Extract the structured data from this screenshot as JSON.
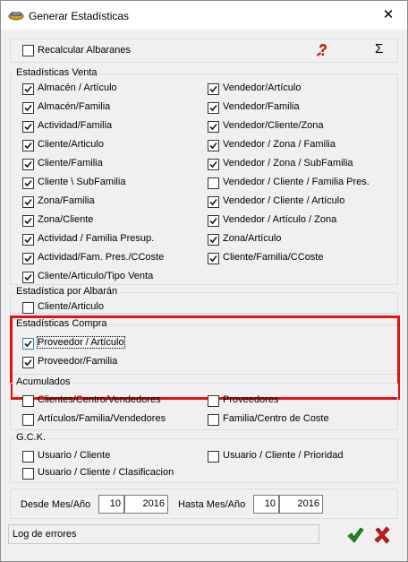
{
  "window": {
    "title": "Generar Estadísticas"
  },
  "top": {
    "recalcular_label": "Recalcular Albaranes",
    "sigma_symbol": "Σ"
  },
  "venta": {
    "title": "Estadísticas Venta",
    "left": [
      {
        "label": "Almacén / Artículo",
        "checked": true
      },
      {
        "label": "Almacén/Familia",
        "checked": true
      },
      {
        "label": "Actividad/Familia",
        "checked": true
      },
      {
        "label": "Cliente/Articulo",
        "checked": true
      },
      {
        "label": "Cliente/Familia",
        "checked": true
      },
      {
        "label": "Cliente \\ SubFamilia",
        "checked": true
      },
      {
        "label": "Zona/Familia",
        "checked": true
      },
      {
        "label": "Zona/Cliente",
        "checked": true
      },
      {
        "label": "Actividad / Familia Presup.",
        "checked": true
      },
      {
        "label": "Actividad/Fam. Pres./CCoste",
        "checked": true
      },
      {
        "label": "Cliente/Articulo/Tipo Venta",
        "checked": true
      }
    ],
    "right": [
      {
        "label": "Vendedor/Artículo",
        "checked": true
      },
      {
        "label": "Vendedor/Familia",
        "checked": true
      },
      {
        "label": "Vendedor/Cliente/Zona",
        "checked": true
      },
      {
        "label": "Vendedor / Zona / Familia",
        "checked": true
      },
      {
        "label": "Vendedor / Zona / SubFamilia",
        "checked": true
      },
      {
        "label": "Vendedor / Cliente / Familia Pres.",
        "checked": false
      },
      {
        "label": "Vendedor / Cliente / Artículo",
        "checked": true
      },
      {
        "label": "Vendedor / Artículo / Zona",
        "checked": true
      },
      {
        "label": "Zona/Artículo",
        "checked": true
      },
      {
        "label": "Cliente/Familia/CCoste",
        "checked": true
      }
    ]
  },
  "albaran": {
    "title": "Estadística por Albarán",
    "items": [
      {
        "label": "Cliente/Articulo",
        "checked": false
      }
    ]
  },
  "compra": {
    "title": "Estadísticas Compra",
    "items": [
      {
        "label": "Proveedor / Artículo",
        "checked": true
      },
      {
        "label": "Proveedor/Familia",
        "checked": true
      }
    ]
  },
  "acumulados": {
    "title": "Acumulados",
    "items": [
      {
        "label": "Clientes/Centro/Vendedores",
        "checked": false
      },
      {
        "label": "Proveedores",
        "checked": false
      },
      {
        "label": "Artículos/Familia/Vendedores",
        "checked": false
      },
      {
        "label": "Familia/Centro de Coste",
        "checked": false
      }
    ]
  },
  "gck": {
    "title": "G.C.K.",
    "items": [
      {
        "label": "Usuario / Cliente",
        "checked": false
      },
      {
        "label": "Usuario / Cliente / Prioridad",
        "checked": false
      },
      {
        "label": "Usuario / Cliente / Clasificacion",
        "checked": false
      }
    ]
  },
  "dates": {
    "desde_label": "Desde Mes/Año",
    "desde_mes": "10",
    "desde_anio": "2016",
    "hasta_label": "Hasta Mes/Año",
    "hasta_mes": "10",
    "hasta_anio": "2016"
  },
  "status": {
    "log_label": "Log de errores"
  },
  "colors": {
    "accept": "#1e8c1e",
    "cancel": "#d01818",
    "highlight": "#e21212"
  },
  "icons": [
    "app-icon",
    "close-icon",
    "help-icon",
    "sigma-icon",
    "check-mark-icon",
    "cancel-x-icon"
  ]
}
